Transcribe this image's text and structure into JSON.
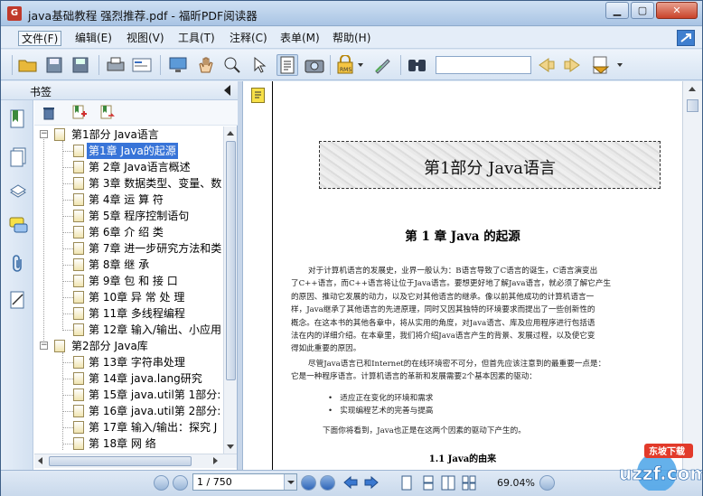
{
  "window": {
    "title": "java基础教程 强烈推荐.pdf - 福昕PDF阅读器"
  },
  "menu": [
    {
      "label": "文件(F)"
    },
    {
      "label": "编辑(E)"
    },
    {
      "label": "视图(V)"
    },
    {
      "label": "工具(T)"
    },
    {
      "label": "注释(C)"
    },
    {
      "label": "表单(M)"
    },
    {
      "label": "帮助(H)"
    }
  ],
  "toolbar": {
    "search_value": "",
    "stamp_label": "RMS"
  },
  "panel": {
    "title": "书签"
  },
  "bookmarks": [
    {
      "label": "第1部分  Java语言",
      "level": 0,
      "expanded": true
    },
    {
      "label": "第1章  Java的起源",
      "level": 1,
      "selected": true
    },
    {
      "label": "第 2章  Java语言概述",
      "level": 1
    },
    {
      "label": "第 3章  数据类型、变量、数",
      "level": 1
    },
    {
      "label": "第 4章  运 算 符",
      "level": 1
    },
    {
      "label": "第 5章  程序控制语句",
      "level": 1
    },
    {
      "label": "第 6章  介 绍 类",
      "level": 1
    },
    {
      "label": "第 7章  进一步研究方法和类",
      "level": 1
    },
    {
      "label": "第 8章  继  承",
      "level": 1
    },
    {
      "label": "第 9章  包 和 接 口",
      "level": 1
    },
    {
      "label": "第 10章  异 常 处 理",
      "level": 1
    },
    {
      "label": "第 11章  多线程编程",
      "level": 1
    },
    {
      "label": "第 12章  输入/输出、小应用",
      "level": 1
    },
    {
      "label": "第2部分  Java库",
      "level": 0,
      "expanded": true
    },
    {
      "label": "第 13章  字符串处理",
      "level": 1
    },
    {
      "label": "第 14章  java.lang研究",
      "level": 1
    },
    {
      "label": "第 15章  java.util第 1部分:",
      "level": 1
    },
    {
      "label": "第 16章  java.util第 2部分:",
      "level": 1
    },
    {
      "label": "第 17章  输入/输出：探究 J",
      "level": 1
    },
    {
      "label": "第 18章  网  络",
      "level": 1
    }
  ],
  "document": {
    "part_title": "第1部分   Java语言",
    "chapter_title": "第 1 章    Java 的起源",
    "paragraph1": [
      "对于计算机语言的发展史，业界一般认为：B语言导致了C语言的诞生，C语言演变出",
      "了C++语言，而C++语言将让位于Java语言。要想更好地了解Java语言，就必须了解它产生",
      "的原因、推动它发展的动力，以及它对其他语言的继承。像以前其他成功的计算机语言一",
      "样，Java继承了其他语言的先进原理，同时又因其独特的环境要求而提出了一些创新性的",
      "概念。在这本书的其他各章中，将从实用的角度，对Java语言、库及应用程序进行包括语",
      "法在内的详细介绍。在本章里，我们将介绍Java语言产生的背景、发展过程，以及使它变",
      "得如此重要的原因。"
    ],
    "paragraph2": [
      "尽管Java语言已和Internet的在线环境密不可分，但首先应该注意到的最重要一点是：",
      "它是一种程序语言。计算机语言的革新和发展需要2个基本因素的驱动："
    ],
    "bullets": [
      "适应正在变化的环境和需求",
      "实现编程艺术的完善与提高"
    ],
    "paragraph3": "下面你将看到，Java也正是在这两个因素的驱动下产生的。",
    "section_title": "1.1    Java的由来"
  },
  "status": {
    "page_display": "1 / 750",
    "zoom": "69.04%"
  },
  "watermark": {
    "top": "东坡下载",
    "bottom": "uzzf.com"
  }
}
